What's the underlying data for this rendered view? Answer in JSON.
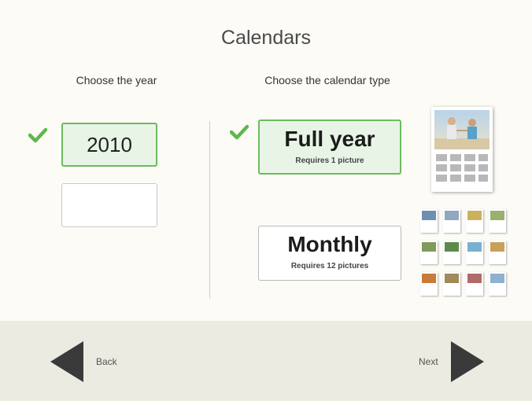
{
  "page": {
    "title": "Calendars"
  },
  "year_section": {
    "label": "Choose the year",
    "selected_year": "2010",
    "empty_option": ""
  },
  "type_section": {
    "label": "Choose the calendar type",
    "options": [
      {
        "name": "Full year",
        "requirement": "Requires 1 picture",
        "selected": true
      },
      {
        "name": "Monthly",
        "requirement": "Requires 12 pictures",
        "selected": false
      }
    ]
  },
  "nav": {
    "back_label": "Back",
    "next_label": "Next"
  },
  "colors": {
    "accent_green": "#5cb84c",
    "selected_fill": "#e8f5e6",
    "footer_bg": "#ecebe1",
    "arrow": "#3a3a3a"
  },
  "icons": {
    "check": "check-icon",
    "back": "back-arrow-icon",
    "next": "next-arrow-icon"
  }
}
